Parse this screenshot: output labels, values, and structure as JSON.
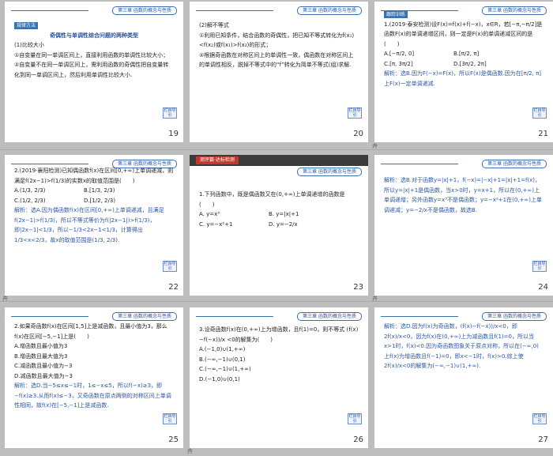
{
  "header_chapter": "第三章  函数的概念与性质",
  "tools_label": "栏目导引",
  "corner_mark": "卉",
  "slides": [
    {
      "num": "19",
      "tag": "规律方法",
      "title": "奇偶性与单调性综合问题的两种类型",
      "lines": [
        "(1)比较大小",
        "①自变量在同一单调区间上，直接利用函数的单调性比较大小；",
        "②自变量不在同一单调区间上，需利用函数的奇偶性把自变量转化到同一单调区间上，然后利用单调性比较大小."
      ]
    },
    {
      "num": "20",
      "lines": [
        "(2)解不等式",
        "①利用已知条件，结合函数的奇偶性，把已知不等式转化为f(x₁)<f(x₂)或f(x₁)>f(x₂)的形式；",
        "②根据奇函数在对称区间上的单调性一致，偶函数在对称区间上的单调性相反，脱掉不等式中的“f”转化为简单不等式(组)求解."
      ]
    },
    {
      "num": "21",
      "tag": "跟踪训练",
      "lines": [
        "1.(2019·泰安检测)设F(x)=f(x)+f(−x)，x∈R，若[−π,−π/2]是函数F(x)的单调递增区间，则一定是F(x)的单调递减区间的是(　　)"
      ],
      "options": [
        "A.[−π/2, 0]",
        "B.[π/2, π]",
        "C.[π, 3π/2]",
        "D.[3π/2, 2π]"
      ],
      "answer": "解析：选B.因为F(−x)=F(x)，所以F(x)是偶函数.因为在[π/2, π]上F(x)一定单调递减."
    },
    {
      "num": "22",
      "lines": [
        "2.(2019·襄阳检测)已知偶函数f(x)在区间[0,+∞)上单调递减，则满足f(2x−1)>f(1/3)的实数x的取值范围是(　　)"
      ],
      "options": [
        "A.(1/3, 2/3)",
        "B.[1/3, 2/3)",
        "C.(1/2, 2/3)",
        "D.[1/2, 2/3)"
      ],
      "answer": "解析：选A.因为偶函数f(x)在区间[0,+∞)上单调递减，且满足f(2x−1)>f(1/3)，所以不等式等价为f(|2x−1|)>f(1/3)，即|2x−1|<1/3，所以−1/3<2x−1<1/3，计算得出1/3<x<2/3，故x的取值范围是(1/3, 2/3)."
    },
    {
      "num": "23",
      "banner": "测评篇·达标检测",
      "lines": [
        "1.下列函数中，既是偶函数又在(0,+∞)上单调递增的函数是(　　)"
      ],
      "options": [
        "A. y=x³",
        "B. y=|x|+1",
        "C. y=−x²+1",
        "D. y=−2/x"
      ]
    },
    {
      "num": "24",
      "answer": "解析：选B.对于函数y=|x|+1，f(−x)=|−x|+1=|x|+1=f(x)，所以y=|x|+1是偶函数，当x>0时，y=x+1，所以在(0,+∞)上单调递增；另外函数y=x³不是偶函数；y=−x²+1在(0,+∞)上单调递减；y=−2/x不是偶函数，故选B."
    },
    {
      "num": "25",
      "lines": [
        "2.如果奇函数f(x)在区间[1,5]上是减函数，且最小值为3，那么f(x)在区间[−5,−1]上是(　　)"
      ],
      "options": [
        "A.增函数且最小值为3",
        "B.增函数且最大值为3",
        "C.减函数且最小值为−3",
        "D.减函数且最大值为−3"
      ],
      "answer": "解析：选D.当−5≤x≤−1时，1≤−x≤5，所以f(−x)≥3，即−f(x)≥3.从而f(x)≤−3，又奇函数在原点两侧的对称区间上单调性相同，故f(x)在[−5,−1]上是减函数."
    },
    {
      "num": "26",
      "lines": [
        "3.设奇函数f(x)在(0,+∞)上为增函数，且f(1)=0，则不等式 (f(x)−f(−x))/x <0的解集为(　　)"
      ],
      "options": [
        "A.(−1,0)∪(1,+∞)",
        "B.(−∞,−1)∪(0,1)",
        "C.(−∞,−1)∪(1,+∞)",
        "D.(−1,0)∪(0,1)"
      ]
    },
    {
      "num": "27",
      "answer": "解析：选D.因为f(x)为奇函数，(f(x)−f(−x))/x<0，即2f(x)/x<0，因为f(x)在(0,+∞)上为减函数且f(1)=0，所以当x>1时，f(x)<0.因为奇函数图象关于原点对称，所以在(−∞,0)上f(x)为增函数且f(−1)=0，即x<−1时，f(x)>0.综上使2f(x)/x<0的解集为(−∞,−1)∪(1,+∞)."
    }
  ]
}
